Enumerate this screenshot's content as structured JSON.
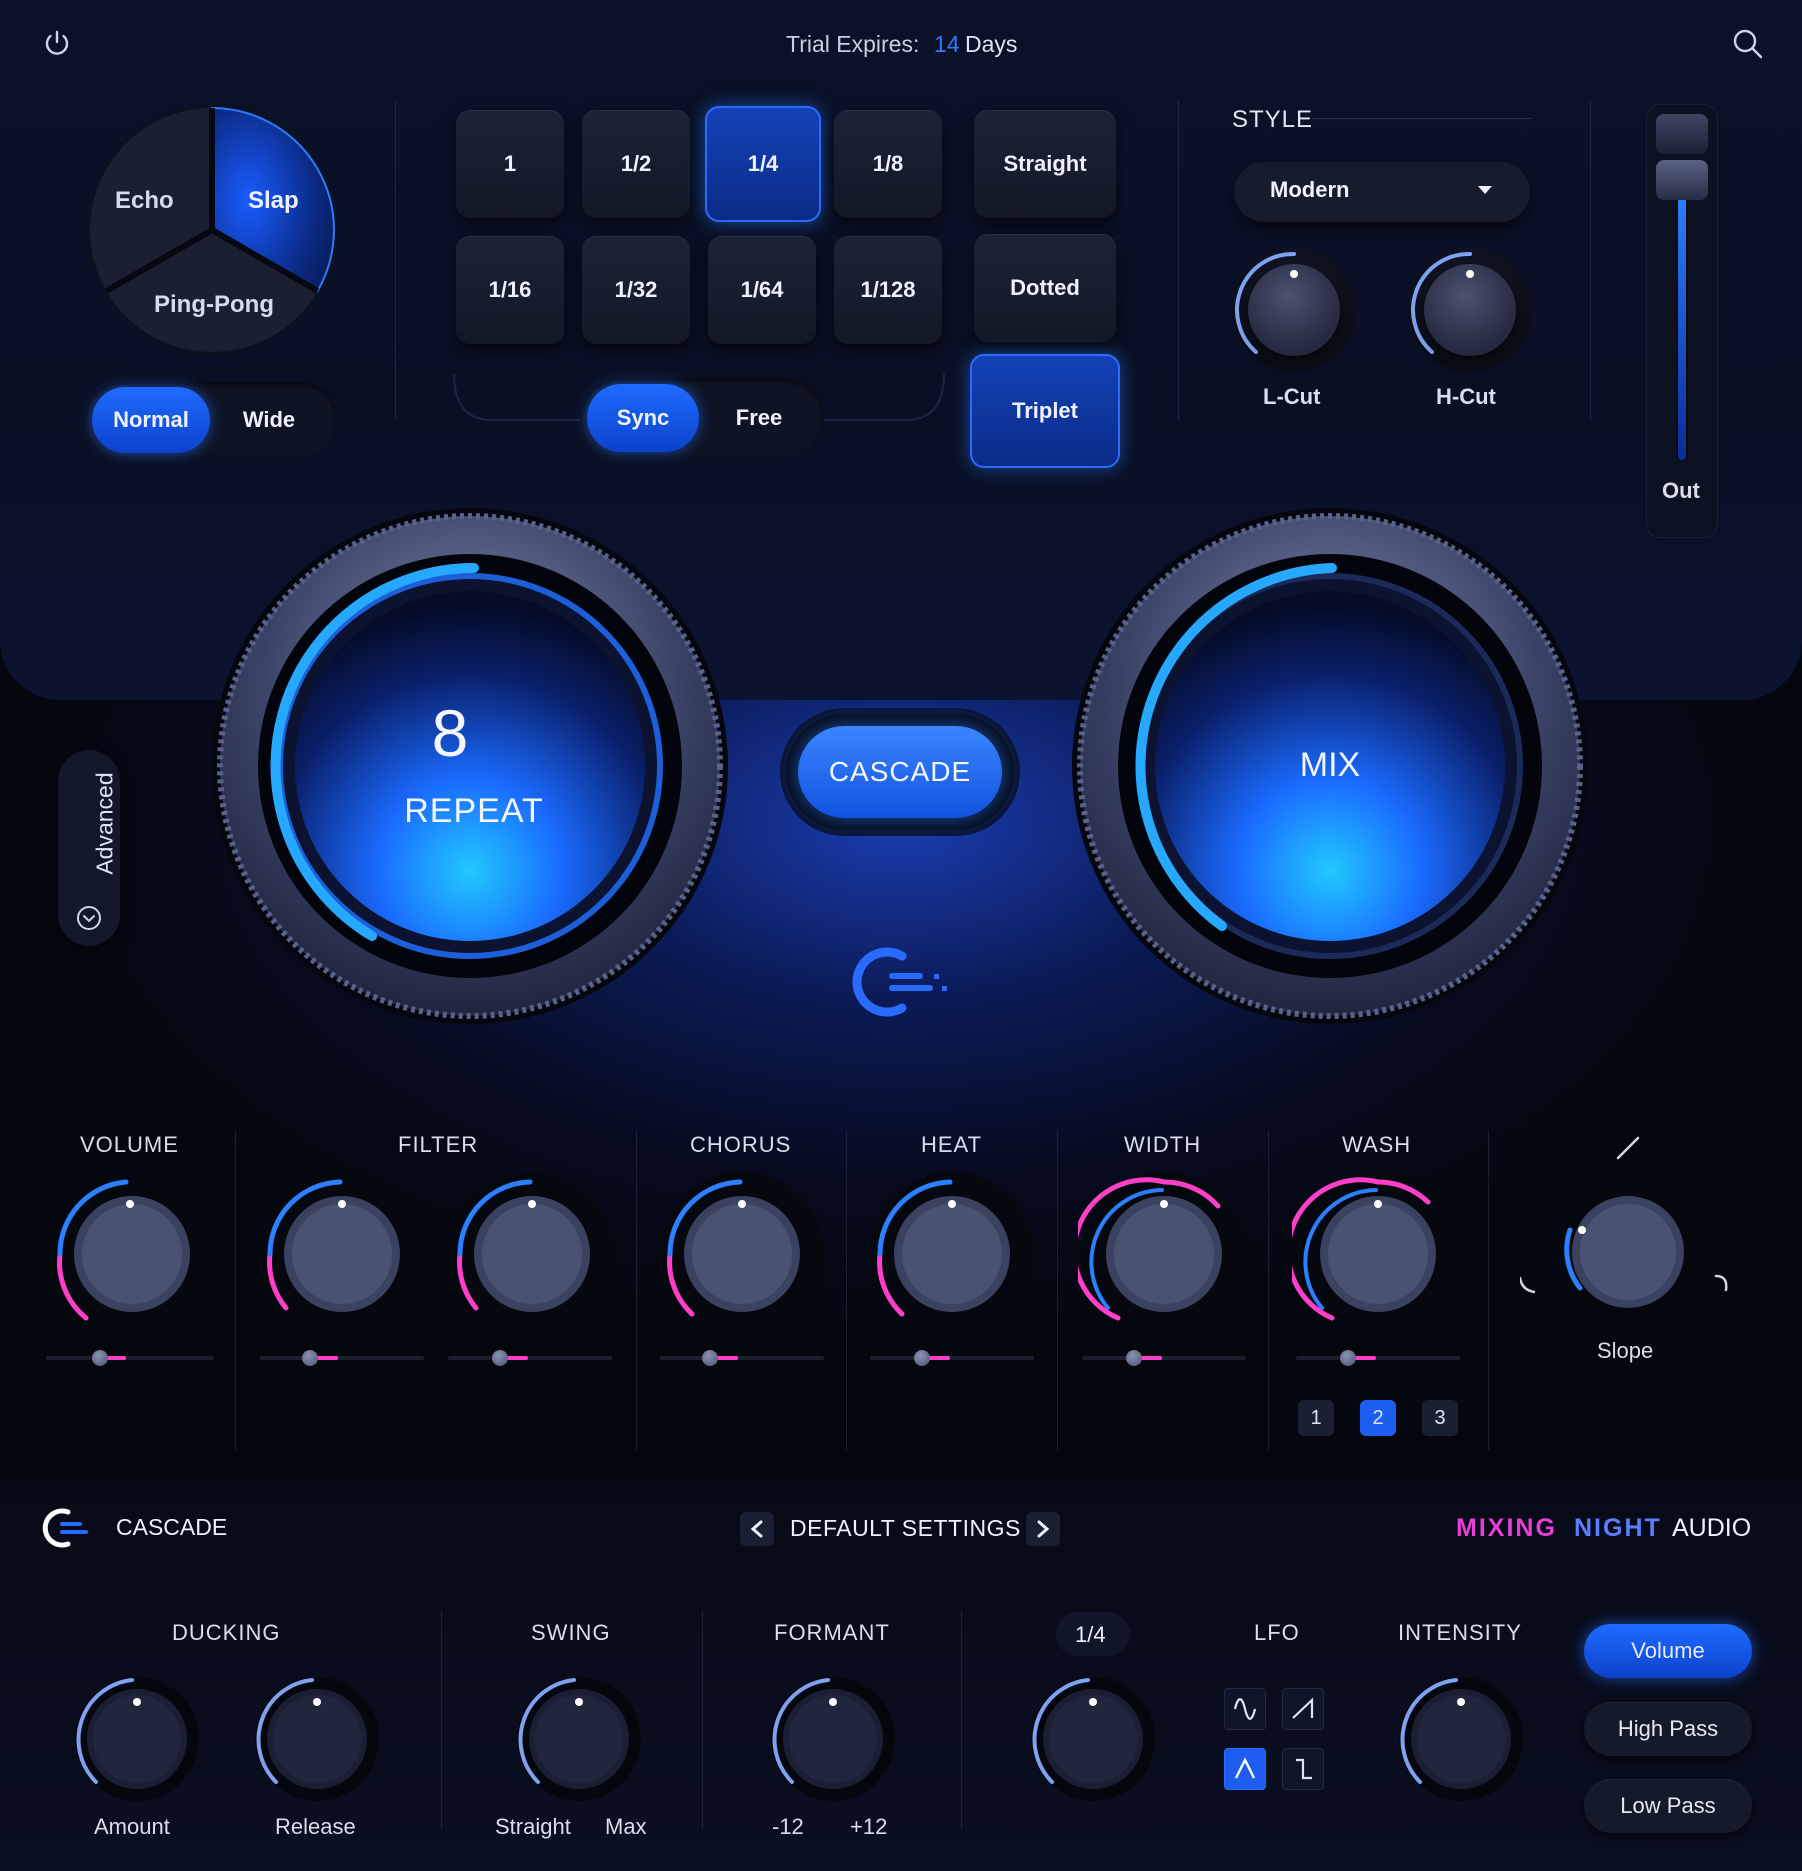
{
  "header": {
    "trial_label": "Trial Expires:",
    "trial_days": "14",
    "trial_unit": "Days"
  },
  "mode_wheel": {
    "echo": "Echo",
    "slap": "Slap",
    "ping_pong": "Ping-Pong",
    "selected": "Slap"
  },
  "stereo_toggle": {
    "normal": "Normal",
    "wide": "Wide",
    "selected": "Normal"
  },
  "divisions": [
    "1",
    "1/2",
    "1/4",
    "1/8",
    "1/16",
    "1/32",
    "1/64",
    "1/128"
  ],
  "division_selected": "1/4",
  "feel": {
    "straight": "Straight",
    "dotted": "Dotted",
    "triplet": "Triplet",
    "selected": "Triplet"
  },
  "sync_toggle": {
    "sync": "Sync",
    "free": "Free",
    "selected": "Sync"
  },
  "style": {
    "title": "STYLE",
    "value": "Modern",
    "lcut_label": "L-Cut",
    "hcut_label": "H-Cut"
  },
  "output": {
    "label": "Out"
  },
  "main": {
    "repeat_value": "8",
    "repeat_label": "REPEAT",
    "brand_button": "CASCADE",
    "mix_label": "MIX",
    "advanced_label": "Advanced"
  },
  "fx": {
    "volume": "VOLUME",
    "filter": "FILTER",
    "chorus": "CHORUS",
    "heat": "HEAT",
    "width": "WIDTH",
    "wash": "WASH",
    "slope": "Slope",
    "wash_modes": [
      "1",
      "2",
      "3"
    ],
    "wash_selected": "2"
  },
  "footer": {
    "product": "CASCADE",
    "preset": "DEFAULT SETTINGS",
    "brand_a": "MIXING",
    "brand_b": "NIGHT",
    "brand_c": "AUDIO"
  },
  "bottom": {
    "ducking": "DUCKING",
    "amount": "Amount",
    "release": "Release",
    "swing": "SWING",
    "swing_min": "Straight",
    "swing_max": "Max",
    "formant": "FORMANT",
    "formant_min": "-12",
    "formant_max": "+12",
    "rate": "1/4",
    "lfo": "LFO",
    "intensity": "INTENSITY",
    "targets": [
      "Volume",
      "High Pass",
      "Low Pass"
    ],
    "target_selected": "Volume"
  },
  "colors": {
    "accent": "#1f6bff",
    "magenta": "#ff3fc8",
    "cyan": "#21c8ff"
  }
}
